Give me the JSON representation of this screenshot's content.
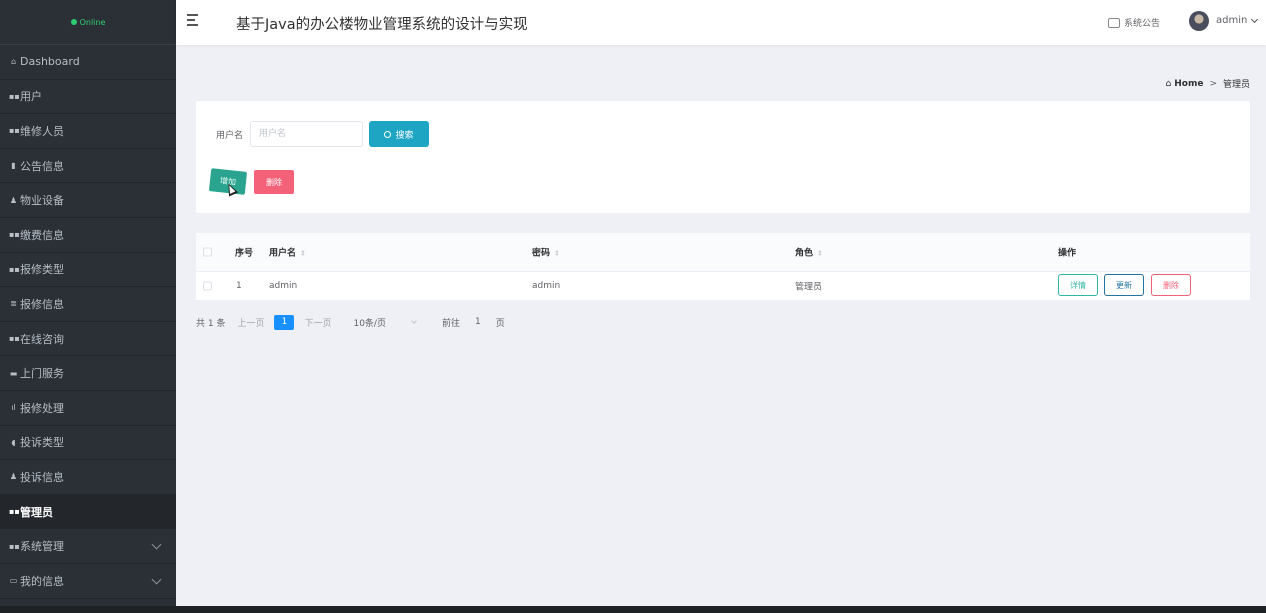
{
  "sidebar": {
    "status": "Online",
    "items": [
      {
        "icon": "home-icon",
        "glyph": "⌂",
        "label": "Dashboard"
      },
      {
        "icon": "grid-icon",
        "glyph": "▪▪",
        "label": "用户"
      },
      {
        "icon": "grid-icon",
        "glyph": "▪▪",
        "label": "维修人员"
      },
      {
        "icon": "doc-icon",
        "glyph": "▮",
        "label": "公告信息"
      },
      {
        "icon": "person-icon",
        "glyph": "♟",
        "label": "物业设备"
      },
      {
        "icon": "grid-icon",
        "glyph": "▪▪",
        "label": "缴费信息"
      },
      {
        "icon": "grid-icon",
        "glyph": "▪▪",
        "label": "报修类型"
      },
      {
        "icon": "list-icon",
        "glyph": "≣",
        "label": "报修信息"
      },
      {
        "icon": "grid-icon",
        "glyph": "▪▪",
        "label": "在线咨询"
      },
      {
        "icon": "case-icon",
        "glyph": "▬",
        "label": "上门服务"
      },
      {
        "icon": "bar-chart-icon",
        "glyph": "ıl",
        "label": "报修处理"
      },
      {
        "icon": "thumb-icon",
        "glyph": "◖",
        "label": "投诉类型"
      },
      {
        "icon": "person-icon",
        "glyph": "♟",
        "label": "投诉信息"
      },
      {
        "icon": "grid-icon",
        "glyph": "▪▪",
        "label": "管理员"
      },
      {
        "icon": "grid-icon",
        "glyph": "▪▪",
        "label": "系统管理"
      },
      {
        "icon": "card-icon",
        "glyph": "▭",
        "label": "我的信息"
      }
    ]
  },
  "header": {
    "title": "基于Java的办公楼物业管理系统的设计与实现",
    "notice": "系统公告",
    "user": "admin"
  },
  "breadcrumb": {
    "home": "Home",
    "separator": ">",
    "current": "管理员"
  },
  "search": {
    "label": "用户名",
    "placeholder": "用户名",
    "button": "搜索"
  },
  "actions": {
    "add": "增加",
    "delete": "删除"
  },
  "table": {
    "columns": [
      "序号",
      "用户名",
      "密码",
      "角色",
      "操作"
    ],
    "rows": [
      {
        "index": "1",
        "username": "admin",
        "password": "admin",
        "role": "管理员"
      }
    ],
    "row_actions": {
      "detail": "详情",
      "update": "更新",
      "delete": "删除"
    }
  },
  "pagination": {
    "total": "共 1 条",
    "prev": "上一页",
    "current_page": "1",
    "next": "下一页",
    "page_size": "10条/页",
    "goto_prefix": "前往",
    "goto_value": "1",
    "goto_suffix": "页"
  },
  "colors": {
    "sidebar_bg": "#2b3036",
    "search_button": "#1ea5c4",
    "add_button": "#2aa48f",
    "delete_button": "#f4627a",
    "page_active": "#1890ff"
  }
}
